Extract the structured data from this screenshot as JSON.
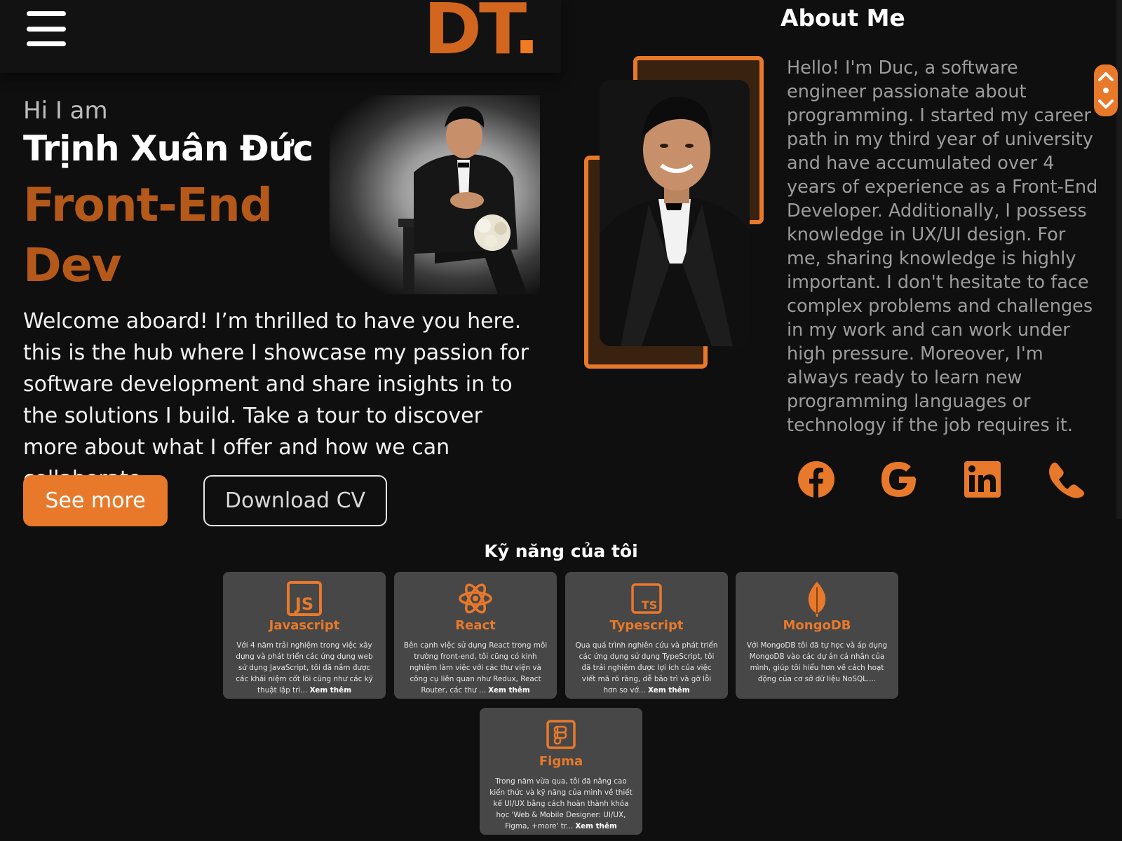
{
  "header": {
    "logo_text": "DT",
    "logo_dot": "."
  },
  "hero": {
    "greeting": "Hi I am",
    "name": "Trịnh Xuân Đức",
    "role": "Front-End Dev",
    "description": "Welcome aboard! I’m thrilled to have you here. this is the hub where I showcase my passion for software development and share insights in to the solutions I build. Take a tour to discover more about what I offer and how we can collaborate.",
    "see_more_label": "See more",
    "download_cv_label": "Download CV"
  },
  "about": {
    "title": "About Me",
    "text": "Hello! I'm Duc, a software engineer passionate about programming. I started my career path in my third year of university and have accumulated over 4 years of experience as a Front-End Developer. Additionally, I possess knowledge in UX/UI design. For me, sharing knowledge is highly important. I don't hesitate to face complex problems and challenges in my work and can work under high pressure. Moreover, I'm always ready to learn new programming languages or technology if the job requires it.",
    "socials": [
      {
        "name": "facebook-icon"
      },
      {
        "name": "google-icon"
      },
      {
        "name": "linkedin-icon"
      },
      {
        "name": "phone-icon"
      }
    ]
  },
  "skills": {
    "title": "Kỹ năng của tôi",
    "more_label": "Xem thêm",
    "items": [
      {
        "icon": "javascript-icon",
        "title": "Javascript",
        "text": "Với 4 năm trải nghiệm trong việc xây dựng và phát triển các ứng dụng web sử dụng JavaScript, tôi đã nắm được các khái niệm cốt lõi cũng như các kỹ thuật lập trì...",
        "has_more": true
      },
      {
        "icon": "react-icon",
        "title": "React",
        "text": "Bên cạnh việc sử dụng React trong môi trường front-end, tôi cũng có kinh nghiệm làm việc với các thư viện và công cụ liên quan như Redux, React Router, các thư ...",
        "has_more": true
      },
      {
        "icon": "typescript-icon",
        "title": "Typescript",
        "text": "Qua quá trình nghiên cứu và phát triển các ứng dụng sử dụng TypeScript, tôi đã trải nghiệm được lợi ích của việc viết mã rõ ràng, dễ bảo trì và gỡ lỗi hơn so vớ...",
        "has_more": true
      },
      {
        "icon": "mongodb-icon",
        "title": "MongoDB",
        "text": "Với MongoDB tôi đã tự học và áp dụng MongoDB vào các dự án cá nhân của mình, giúp tôi hiểu hơn về cách hoạt động của cơ sở dữ liệu NoSQL....",
        "has_more": false
      },
      {
        "icon": "figma-icon",
        "title": "Figma",
        "text": "Trong năm vừa qua, tôi đã nâng cao kiến thức và kỹ năng của mình về thiết kế UI/UX bằng cách hoàn thành khóa học 'Web & Mobile Designer: UI/UX, Figma, +more' tr...",
        "has_more": true
      }
    ]
  },
  "colors": {
    "accent": "#e8792b",
    "background": "#0f0f0f",
    "card": "#474747"
  }
}
